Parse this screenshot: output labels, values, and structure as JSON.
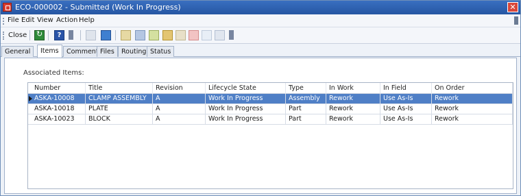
{
  "window": {
    "title": "ECO-000002 - Submitted (Work In Progress)",
    "close_glyph": "✕"
  },
  "menu": {
    "items": [
      "File",
      "Edit",
      "View",
      "Action",
      "Help"
    ]
  },
  "toolbar": {
    "close_label": "Close",
    "help_glyph": "?",
    "icons": [
      "refresh-icon",
      "help-icon",
      "new-icon",
      "add-icon",
      "edit-icon",
      "copy-icon",
      "lock-icon",
      "undo-icon",
      "delete-icon",
      "checkin-icon",
      "properties-icon"
    ]
  },
  "tabs": [
    "General",
    "Items",
    "Comments",
    "Files",
    "Routing",
    "Status"
  ],
  "active_tab": "Items",
  "items_panel": {
    "label": "Associated Items:",
    "columns": [
      "Number",
      "Title",
      "Revision",
      "Lifecycle State",
      "Type",
      "In Work",
      "In Field",
      "On Order"
    ],
    "rows": [
      [
        "ASKA-10008",
        "CLAMP ASSEMBLY",
        "A",
        "Work In Progress",
        "Assembly",
        "Rework",
        "Use As-Is",
        "Rework"
      ],
      [
        "ASKA-10018",
        "PLATE",
        "A",
        "Work In Progress",
        "Part",
        "Rework",
        "Use As-Is",
        "Rework"
      ],
      [
        "ASKA-10023",
        "BLOCK",
        "A",
        "Work In Progress",
        "Part",
        "Rework",
        "Use As-Is",
        "Rework"
      ]
    ],
    "selected_row": 0
  },
  "colors": {
    "titlebar": "#2656a3",
    "selection": "#4f7fc6",
    "close_button": "#d9473a"
  }
}
